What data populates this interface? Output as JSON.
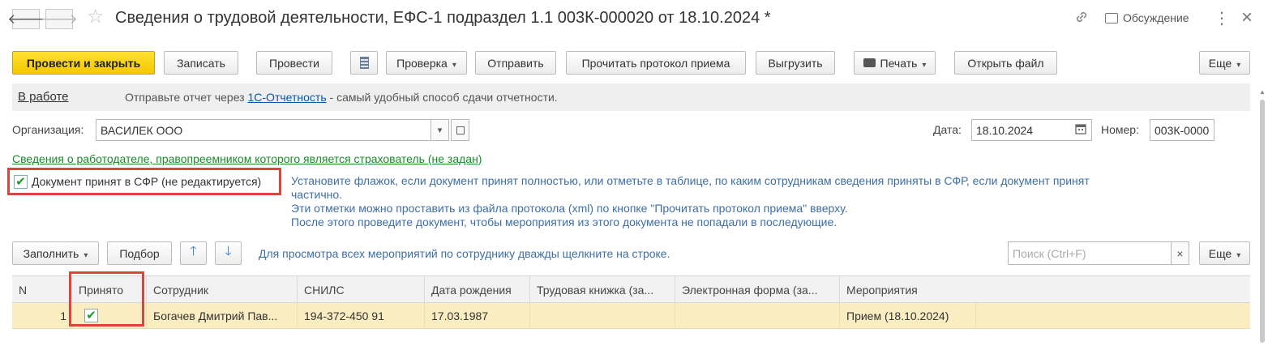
{
  "header": {
    "back_icon": "arrow-left-icon",
    "forward_icon": "arrow-right-icon",
    "title": "Сведения о трудовой деятельности, ЕФС-1 подраздел 1.1 003К-000020 от 18.10.2024 *",
    "discussion_label": "Обсуждение",
    "more_glyph": "⋮",
    "close_glyph": "×"
  },
  "toolbar": {
    "post_close": "Провести и закрыть",
    "save": "Записать",
    "post": "Провести",
    "check": "Проверка",
    "send": "Отправить",
    "read_protocol": "Прочитать протокол приема",
    "upload": "Выгрузить",
    "print": "Печать",
    "open_file": "Открыть файл",
    "more": "Еще"
  },
  "status": {
    "state": "В работе",
    "message_prefix": "Отправьте отчет через",
    "message_link": "1С-Отчетность",
    "message_suffix": "- самый удобный способ сдачи отчетности."
  },
  "form": {
    "org_label": "Организация:",
    "org_value": "ВАСИЛЕК ООО",
    "date_label": "Дата:",
    "date_value": "18.10.2024",
    "number_label": "Номер:",
    "number_value": "003К-0000",
    "employer_link": "Сведения о работодателе, правопреемником которого является страхователь (не задан)",
    "accepted_checkbox_label": "Документ принят в СФР (не редактируется)",
    "accepted_checked": true,
    "hint_lines": [
      "Установите флажок, если документ принят полностью, или отметьте в таблице, по каким сотрудникам сведения приняты в СФР, если документ принят",
      "частично.",
      "Эти отметки можно проставить из файла протокола (xml) по кнопке \"Прочитать протокол приема\" вверху.",
      "После этого проведите документ, чтобы мероприятия из этого документа не попадали в последующие."
    ]
  },
  "table_toolbar": {
    "fill": "Заполнить",
    "select": "Подбор",
    "hint": "Для просмотра всех мероприятий по сотруднику дважды щелкните на строке.",
    "search_placeholder": "Поиск (Ctrl+F)",
    "more": "Еще"
  },
  "table": {
    "columns": [
      "N",
      "Принято",
      "Сотрудник",
      "СНИЛС",
      "Дата рождения",
      "Трудовая книжка (за...",
      "Электронная форма (за...",
      "Мероприятия"
    ],
    "rows": [
      {
        "n": "1",
        "accepted": true,
        "employee": "Богачев Дмитрий Пав...",
        "snils": "194-372-450 91",
        "birth_date": "17.03.1987",
        "work_book": "",
        "electronic_form": "",
        "events": "Прием (18.10.2024)"
      }
    ]
  },
  "colors": {
    "primary_button": "#f5c800",
    "selected_row": "#fbedc2",
    "highlight_box": "#d9463c",
    "link": "#0b57a4",
    "green_link": "#1a8a2a",
    "hint_text": "#3d6ea8"
  }
}
